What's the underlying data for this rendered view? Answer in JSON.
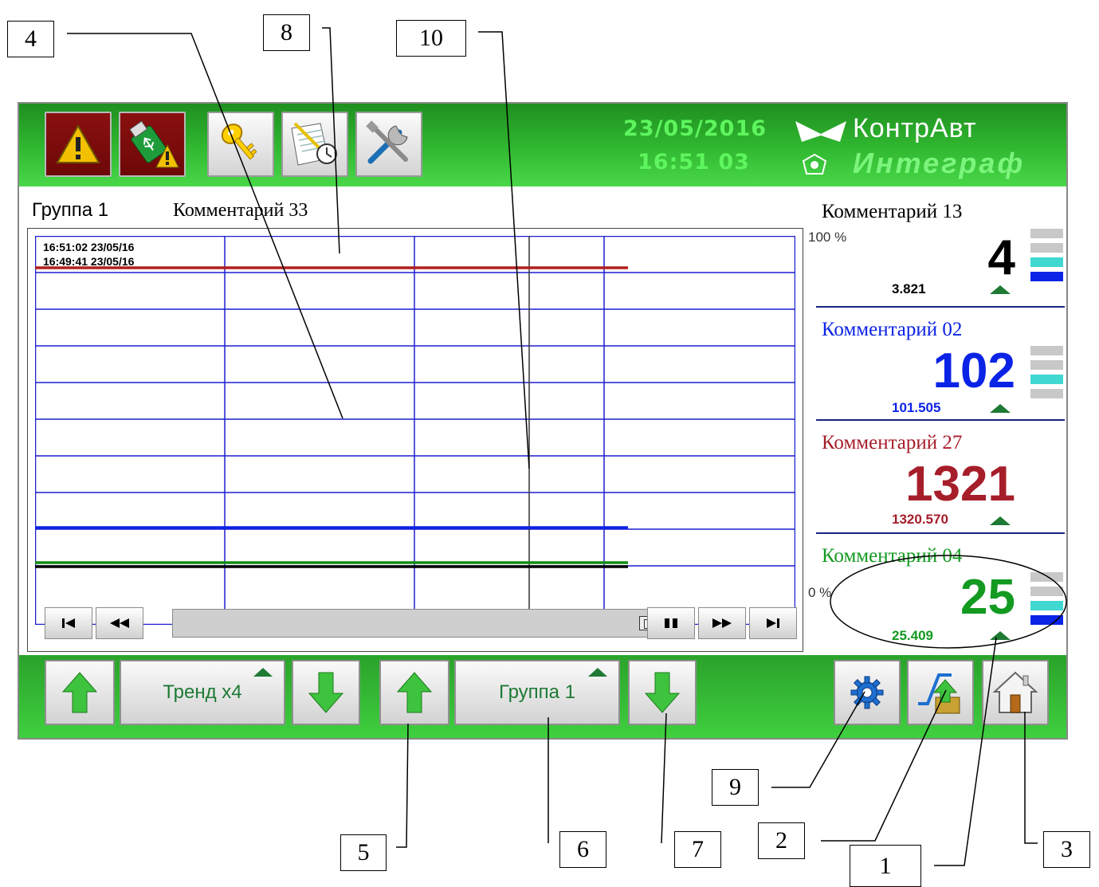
{
  "callouts": [
    "4",
    "8",
    "10",
    "9",
    "2",
    "5",
    "6",
    "7",
    "1",
    "3"
  ],
  "header": {
    "date": "23/05/2016",
    "time": "16:51  03",
    "brand_top": "КонтрАвт",
    "brand_bottom": "Интеграф"
  },
  "toolbar_icons": [
    "alarm-icon",
    "usb-alarm-icon",
    "key-icon",
    "schedule-icon",
    "tools-icon"
  ],
  "group": {
    "name": "Группа 1",
    "comment": "Комментарий 33"
  },
  "trend": {
    "timestamp_top": "16:51:02  23/05/16",
    "timestamp_bottom": "16:49:41  23/05/16",
    "colors": {
      "grid": "#1f1fd0",
      "cursor": "#333333",
      "red": "#b31e1e",
      "blue": "#0b23e6",
      "green": "#118c11",
      "black": "#000000"
    },
    "series_levels": [
      {
        "color": "red",
        "level": 0.96
      },
      {
        "color": "blue",
        "level": 0.25
      },
      {
        "color": "green",
        "level": 0.16
      },
      {
        "color": "black",
        "level": 0.15
      }
    ],
    "data_extent": 0.78,
    "cursor_position": 0.65
  },
  "channels": [
    {
      "comment": "Комментарий 13",
      "value": "4",
      "raw": "3.821",
      "color": "#000000",
      "scale_top": "100 %",
      "bars": [
        "#c8c8c8",
        "#c8c8c8",
        "#40d8d0",
        "#0b23e6"
      ]
    },
    {
      "comment": "Комментарий 02",
      "value": "102",
      "raw": "101.505",
      "color": "#0b23e6",
      "bars": [
        "#c8c8c8",
        "#c8c8c8",
        "#40d8d0",
        "#c8c8c8"
      ]
    },
    {
      "comment": "Комментарий 27",
      "value": "1321",
      "raw": "1320.570",
      "color": "#a61e2a"
    },
    {
      "comment": "Комментарий 04",
      "value": "25",
      "raw": "25.409",
      "color": "#139a20",
      "scale_bottom": "0 %",
      "bars": [
        "#c8c8c8",
        "#c8c8c8",
        "#40d8d0",
        "#0b23e6"
      ]
    }
  ],
  "bottom": {
    "trend_mode": "Тренд x4",
    "group_select": "Группа 1"
  }
}
